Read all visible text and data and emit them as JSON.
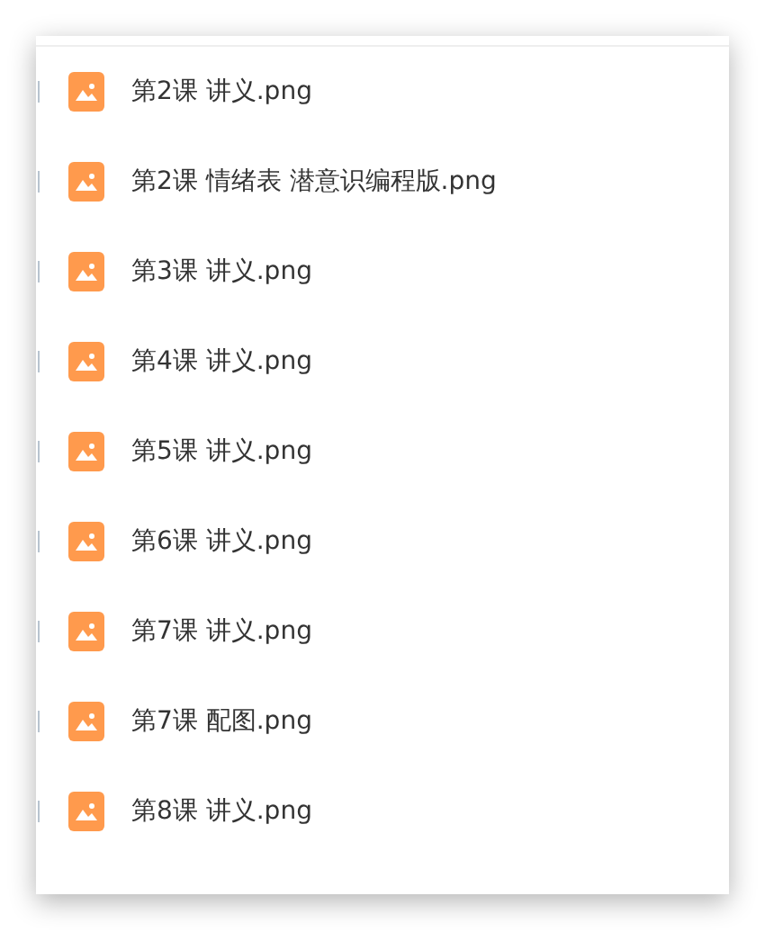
{
  "files": [
    {
      "name": "第2课 讲义.png",
      "kind": "image",
      "checked": false
    },
    {
      "name": "第2课 情绪表 潜意识编程版.png",
      "kind": "image",
      "checked": false
    },
    {
      "name": "第3课 讲义.png",
      "kind": "image",
      "checked": false
    },
    {
      "name": "第4课 讲义.png",
      "kind": "image",
      "checked": false
    },
    {
      "name": "第5课 讲义.png",
      "kind": "image",
      "checked": false
    },
    {
      "name": "第6课 讲义.png",
      "kind": "image",
      "checked": false
    },
    {
      "name": "第7课 讲义.png",
      "kind": "image",
      "checked": false
    },
    {
      "name": "第7课 配图.png",
      "kind": "image",
      "checked": false
    },
    {
      "name": "第8课 讲义.png",
      "kind": "image",
      "checked": false
    }
  ]
}
